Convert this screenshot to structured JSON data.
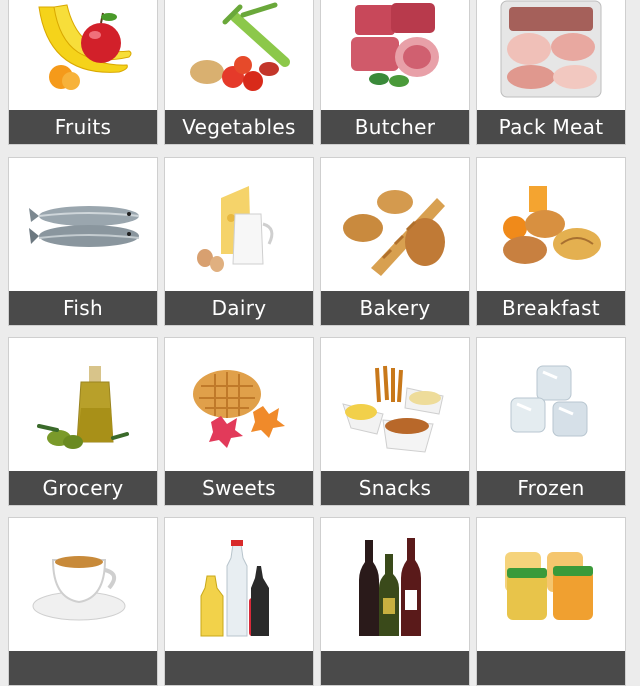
{
  "categories": [
    {
      "label": "Fruits",
      "icon": "fruits-icon"
    },
    {
      "label": "Vegetables",
      "icon": "vegetables-icon"
    },
    {
      "label": "Butcher",
      "icon": "butcher-icon"
    },
    {
      "label": "Pack Meat",
      "icon": "pack-meat-icon"
    },
    {
      "label": "Fish",
      "icon": "fish-icon"
    },
    {
      "label": "Dairy",
      "icon": "dairy-icon"
    },
    {
      "label": "Bakery",
      "icon": "bakery-icon"
    },
    {
      "label": "Breakfast",
      "icon": "breakfast-icon"
    },
    {
      "label": "Grocery",
      "icon": "grocery-icon"
    },
    {
      "label": "Sweets",
      "icon": "sweets-icon"
    },
    {
      "label": "Snacks",
      "icon": "snacks-icon"
    },
    {
      "label": "Frozen",
      "icon": "frozen-icon"
    },
    {
      "label": "",
      "icon": "tea-icon"
    },
    {
      "label": "",
      "icon": "drinks-icon"
    },
    {
      "label": "",
      "icon": "wine-icon"
    },
    {
      "label": "",
      "icon": "baby-food-icon"
    }
  ],
  "colors": {
    "background": "#ececec",
    "tile": "#ffffff",
    "label_bar": "#4a4a4a",
    "label_text": "#ffffff"
  }
}
